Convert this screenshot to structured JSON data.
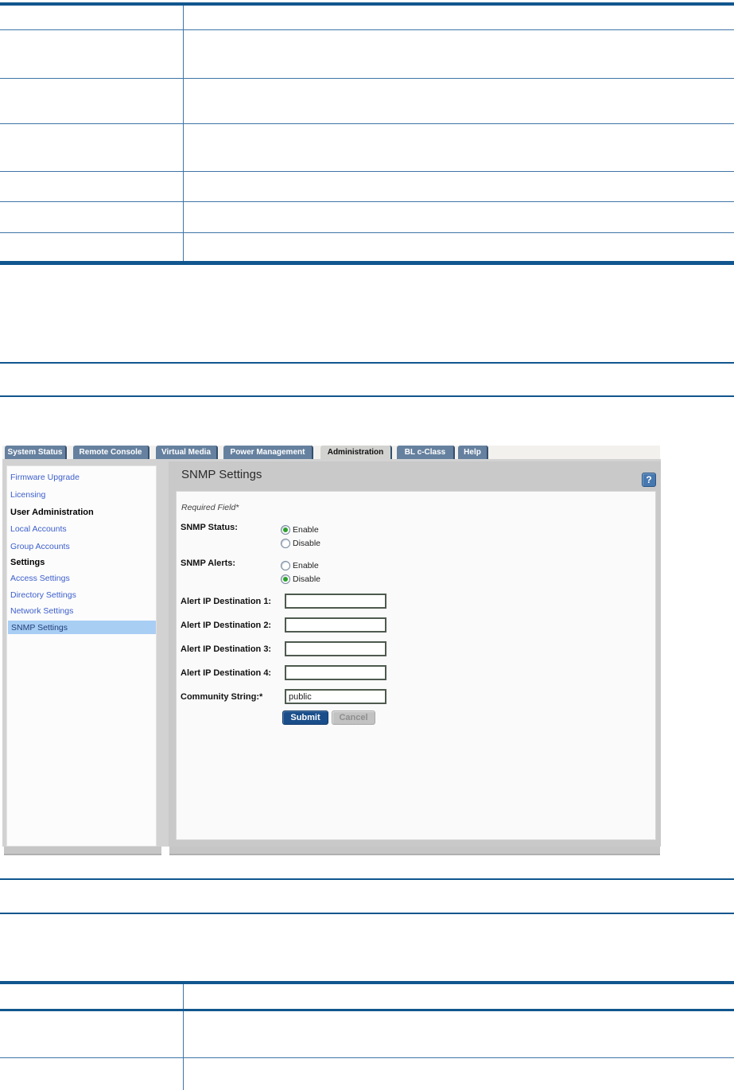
{
  "colors": {
    "table-blue": "#11568E",
    "table-line": "#3F74A6",
    "tab-blue": "#66819F",
    "tab-active-bg": "#D2D2D0",
    "backdrop": "#D2D2D2",
    "panel-chrome": "#C9C9C9",
    "link-blue": "#3C5ECC",
    "highlight-blue": "#A9CEF4",
    "submit-navy": "#1A4E8A",
    "radio-green": "#2CA12C"
  },
  "tabs": [
    {
      "label": "System Status",
      "active": false
    },
    {
      "label": "Remote Console",
      "active": false
    },
    {
      "label": "Virtual Media",
      "active": false
    },
    {
      "label": "Power Management",
      "active": false
    },
    {
      "label": "Administration",
      "active": true
    },
    {
      "label": "BL c-Class",
      "active": false
    },
    {
      "label": "Help",
      "active": false
    }
  ],
  "sidebar": {
    "items": [
      {
        "label": "Firmware Upgrade",
        "type": "link"
      },
      {
        "label": "Licensing",
        "type": "link"
      },
      {
        "label": "User Administration",
        "type": "header"
      },
      {
        "label": "Local Accounts",
        "type": "link"
      },
      {
        "label": "Group Accounts",
        "type": "link"
      },
      {
        "label": "Settings",
        "type": "header"
      },
      {
        "label": "Access Settings",
        "type": "link"
      },
      {
        "label": "Directory Settings",
        "type": "link"
      },
      {
        "label": "Network Settings",
        "type": "link"
      },
      {
        "label": "SNMP Settings",
        "type": "link",
        "selected": true
      }
    ]
  },
  "panel": {
    "title": "SNMP Settings",
    "help_icon": "?",
    "required_note": "Required Field*",
    "snmp_status": {
      "label": "SNMP Status:",
      "enable": "Enable",
      "disable": "Disable",
      "selected": "Enable"
    },
    "snmp_alerts": {
      "label": "SNMP Alerts:",
      "enable": "Enable",
      "disable": "Disable",
      "selected": "Disable"
    },
    "alert_ip_1": {
      "label": "Alert IP Destination 1:",
      "value": ""
    },
    "alert_ip_2": {
      "label": "Alert IP Destination 2:",
      "value": ""
    },
    "alert_ip_3": {
      "label": "Alert IP Destination 3:",
      "value": ""
    },
    "alert_ip_4": {
      "label": "Alert IP Destination 4:",
      "value": ""
    },
    "community": {
      "label": "Community String:*",
      "value": "public"
    },
    "submit_label": "Submit",
    "cancel_label": "Cancel"
  }
}
